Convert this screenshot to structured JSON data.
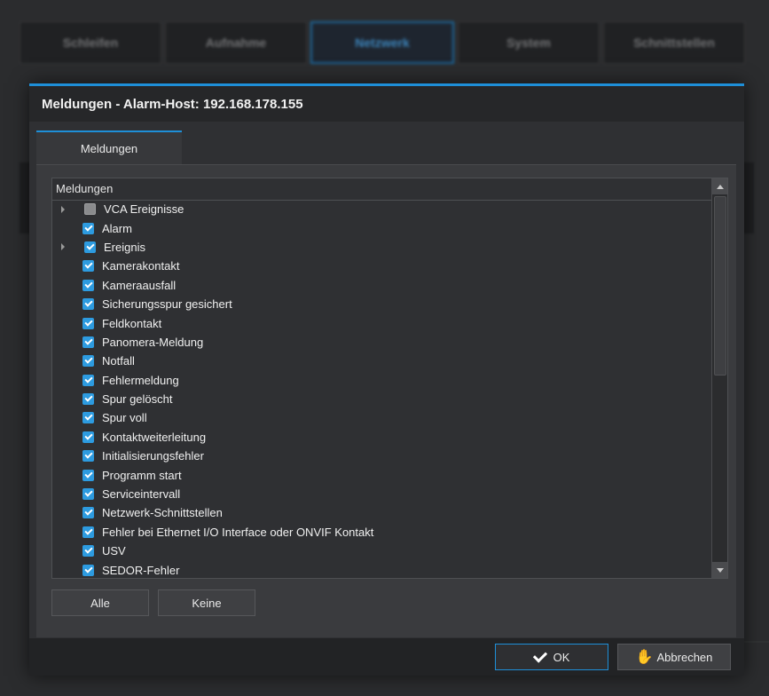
{
  "background_tabs": [
    "Schleifen",
    "Aufnahme",
    "Netzwerk",
    "System",
    "Schnittstellen"
  ],
  "dialog": {
    "title": "Meldungen - Alarm-Host: 192.168.178.155",
    "tab_label": "Meldungen",
    "list_header": "Meldungen",
    "items": [
      {
        "label": "VCA Ereignisse",
        "state": "partial",
        "expandable": true
      },
      {
        "label": "Alarm",
        "state": "checked",
        "expandable": false
      },
      {
        "label": "Ereignis",
        "state": "checked",
        "expandable": true
      },
      {
        "label": "Kamerakontakt",
        "state": "checked",
        "expandable": false
      },
      {
        "label": "Kameraausfall",
        "state": "checked",
        "expandable": false
      },
      {
        "label": "Sicherungsspur gesichert",
        "state": "checked",
        "expandable": false
      },
      {
        "label": "Feldkontakt",
        "state": "checked",
        "expandable": false
      },
      {
        "label": "Panomera-Meldung",
        "state": "checked",
        "expandable": false
      },
      {
        "label": "Notfall",
        "state": "checked",
        "expandable": false
      },
      {
        "label": "Fehlermeldung",
        "state": "checked",
        "expandable": false
      },
      {
        "label": "Spur gelöscht",
        "state": "checked",
        "expandable": false
      },
      {
        "label": "Spur voll",
        "state": "checked",
        "expandable": false
      },
      {
        "label": "Kontaktweiterleitung",
        "state": "checked",
        "expandable": false
      },
      {
        "label": "Initialisierungsfehler",
        "state": "checked",
        "expandable": false
      },
      {
        "label": "Programm start",
        "state": "checked",
        "expandable": false
      },
      {
        "label": "Serviceintervall",
        "state": "checked",
        "expandable": false
      },
      {
        "label": "Netzwerk-Schnittstellen",
        "state": "checked",
        "expandable": false
      },
      {
        "label": "Fehler bei Ethernet I/O Interface oder ONVIF Kontakt",
        "state": "checked",
        "expandable": false
      },
      {
        "label": "USV",
        "state": "checked",
        "expandable": false
      },
      {
        "label": "SEDOR-Fehler",
        "state": "checked",
        "expandable": false
      }
    ],
    "all_button": "Alle",
    "none_button": "Keine",
    "ok_button": "OK",
    "cancel_button": "Abbrechen",
    "accent_color": "#1e8fd8"
  }
}
